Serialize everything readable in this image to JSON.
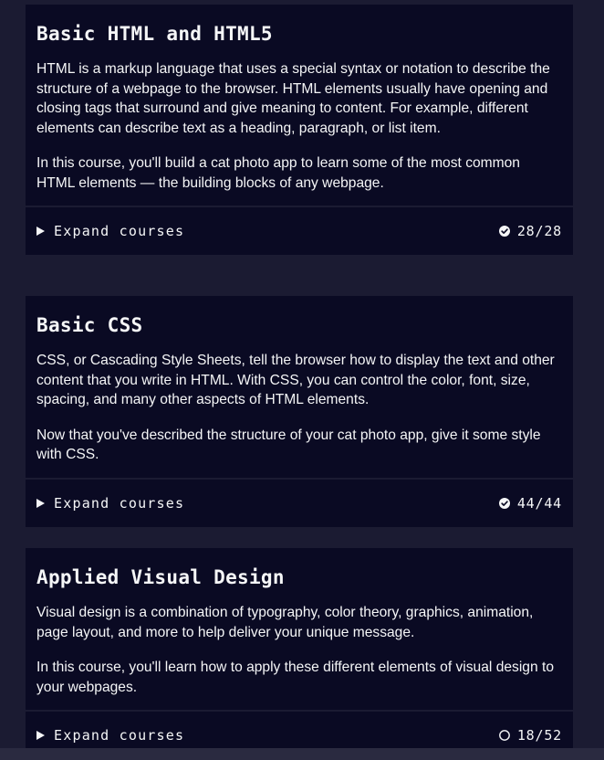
{
  "blocks": [
    {
      "title": "Basic HTML and HTML5",
      "paragraphs": [
        "HTML is a markup language that uses a special syntax or notation to describe the structure of a webpage to the browser. HTML elements usually have opening and closing tags that surround and give meaning to content. For example, different elements can describe text as a heading, paragraph, or list item.",
        "In this course, you'll build a cat photo app to learn some of the most common HTML elements — the building blocks of any webpage."
      ],
      "expand_label": "Expand courses",
      "progress": "28/28",
      "complete": true
    },
    {
      "title": "Basic CSS",
      "paragraphs": [
        "CSS, or Cascading Style Sheets, tell the browser how to display the text and other content that you write in HTML. With CSS, you can control the color, font, size, spacing, and many other aspects of HTML elements.",
        "Now that you've described the structure of your cat photo app, give it some style with CSS."
      ],
      "expand_label": "Expand courses",
      "progress": "44/44",
      "complete": true
    },
    {
      "title": "Applied Visual Design",
      "paragraphs": [
        "Visual design is a combination of typography, color theory, graphics, animation, page layout, and more to help deliver your unique message.",
        "In this course, you'll learn how to apply these different elements of visual design to your webpages."
      ],
      "expand_label": "Expand courses",
      "progress": "18/52",
      "complete": false
    }
  ],
  "icons": {
    "expand": "triangle-right-icon",
    "complete": "check-circle-icon",
    "incomplete": "empty-circle-icon"
  },
  "colors": {
    "page_background": "#1b1b32",
    "block_background": "#0a0a23",
    "text": "#f5f6f7"
  }
}
